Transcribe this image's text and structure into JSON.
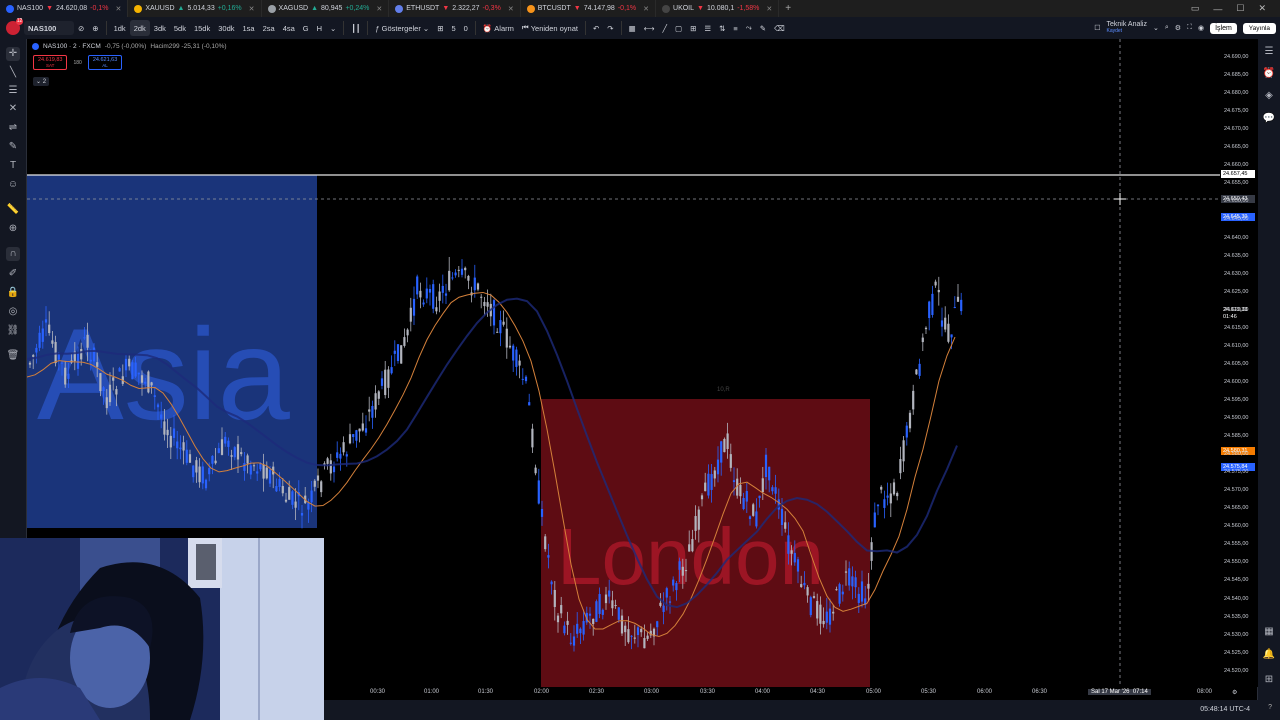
{
  "tabs": [
    {
      "symbol": "NAS100",
      "price": "24.620,08",
      "change": "-0,1%",
      "dir": "down",
      "color": "#2962ff",
      "active": true
    },
    {
      "symbol": "XAUUSD",
      "price": "5.014,33",
      "change": "+0,16%",
      "dir": "up",
      "color": "#f5b300",
      "active": false
    },
    {
      "symbol": "XAGUSD",
      "price": "80,945",
      "change": "+0,24%",
      "dir": "up",
      "color": "#9aa0a6",
      "active": false
    },
    {
      "symbol": "ETHUSDT",
      "price": "2.322,27",
      "change": "-0,3%",
      "dir": "down",
      "color": "#627eea",
      "active": false
    },
    {
      "symbol": "BTCUSDT",
      "price": "74.147,98",
      "change": "-0,1%",
      "dir": "down",
      "color": "#f7931a",
      "active": false
    },
    {
      "symbol": "UKOIL",
      "price": "10.080,1",
      "change": "-1,58%",
      "dir": "down",
      "color": "#444444",
      "active": false
    }
  ],
  "toolbar": {
    "symbol": "NAS100",
    "avatar_badge": "12",
    "intervals": [
      "1dk",
      "2dk",
      "3dk",
      "5dk",
      "15dk",
      "30dk",
      "1sa",
      "2sa",
      "4sa",
      "G",
      "H"
    ],
    "selected_interval": "2dk",
    "indicators_label": "Göstergeler",
    "alarm_label": "Alarm",
    "replay_label": "Yeniden oynat",
    "counter_a": "5",
    "counter_b": "0",
    "analysis_label": "Teknik Analiz",
    "analysis_sub": "Kaydet",
    "trade_label": "İşlem",
    "publish_label": "Yayınla"
  },
  "legend": {
    "title": "NAS100 · 2 · FXCM",
    "change": "-0,75 (-0,00%)",
    "volume": "Hacim299 -25,31 (-0,10%)"
  },
  "order": {
    "sell_price": "24.619,83",
    "sell_label": "SAT",
    "spread": "180",
    "buy_price": "24.621,63",
    "buy_label": "AL"
  },
  "collapse_count": "2",
  "sessions": {
    "asia": "Asia",
    "london": "London",
    "london_top_label": "10,R"
  },
  "price_scale": {
    "ticks": [
      "24.690,00",
      "24.685,00",
      "24.680,00",
      "24.675,00",
      "24.670,00",
      "24.665,00",
      "24.660,00",
      "24.655,00",
      "24.650,00",
      "24.645,00",
      "24.640,00",
      "24.635,00",
      "24.630,00",
      "24.625,00",
      "24.620,00",
      "24.615,00",
      "24.610,00",
      "24.605,00",
      "24.600,00",
      "24.595,00",
      "24.590,00",
      "24.585,00",
      "24.580,00",
      "24.575,00",
      "24.570,00",
      "24.565,00",
      "24.560,00",
      "24.555,00",
      "24.550,00",
      "24.545,00",
      "24.540,00",
      "24.535,00",
      "24.530,00",
      "24.525,00",
      "24.520,00"
    ],
    "hline_price": "24.657,45",
    "crosshair_price": "24.650,43",
    "blue_marker": "24.645,39",
    "last_price": "24.619,33",
    "countdown": "01:46",
    "orange_marker": "24.580,31",
    "blue_marker2": "24.575,84"
  },
  "time_axis": {
    "labels": [
      "00:30",
      "01:00",
      "01:30",
      "02:00",
      "02:30",
      "03:00",
      "03:30",
      "04:00",
      "04:30",
      "05:00",
      "05:30",
      "06:00",
      "06:30",
      "08:00"
    ],
    "crosshair_date": "Sal 17 Mar '26",
    "crosshair_time": "07:14"
  },
  "status": {
    "clock": "05:48:14 UTC-4"
  },
  "colors": {
    "up": "#2962ff",
    "down": "#b2b5be",
    "asia_fill": "#1e3d8f",
    "london_fill": "#6e0e16",
    "ma_orange": "#d4803a",
    "ma_blue": "#1d2a7a"
  }
}
